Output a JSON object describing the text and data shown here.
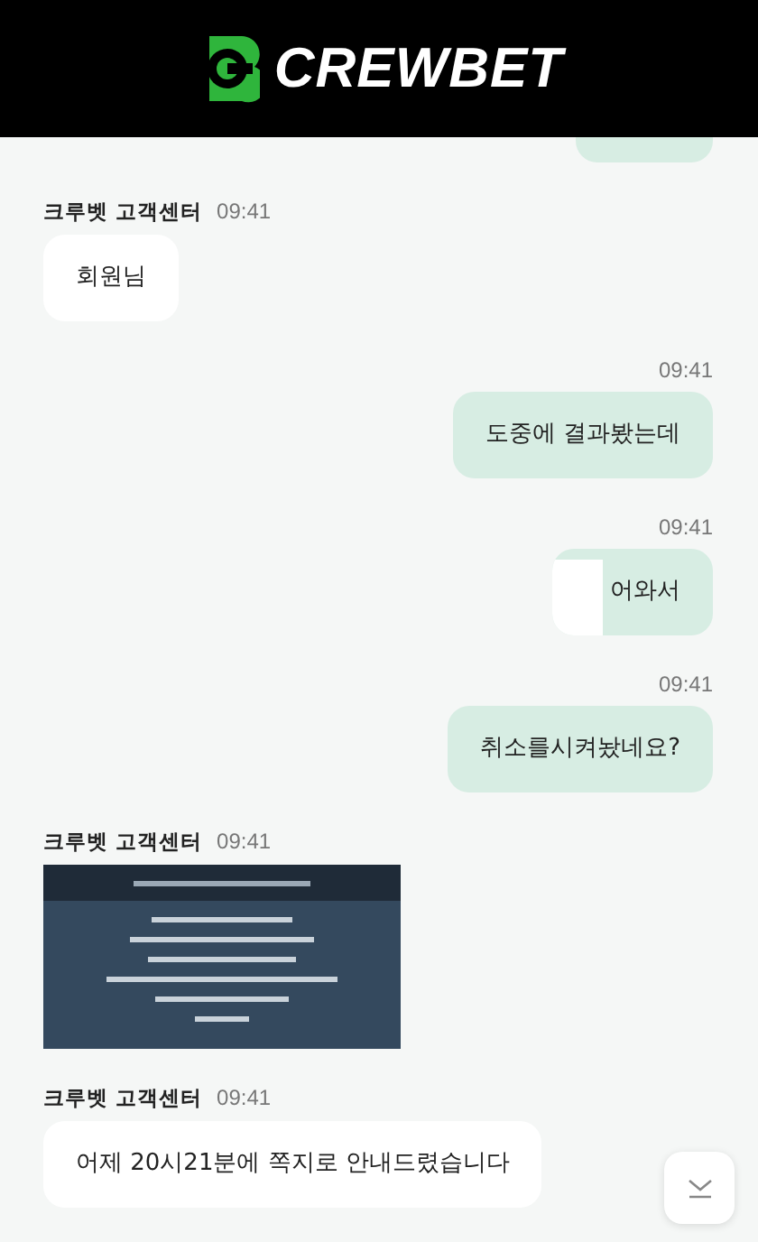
{
  "header": {
    "logo_text": "CREWBET"
  },
  "messages": [
    {
      "kind": "clipped",
      "mine": true
    },
    {
      "kind": "text",
      "mine": false,
      "sender": "크루벳 고객센터",
      "time": "09:41",
      "text": "회원님"
    },
    {
      "kind": "text",
      "mine": true,
      "time": "09:41",
      "text": "도중에 결과봤는데"
    },
    {
      "kind": "text",
      "mine": true,
      "time": "09:41",
      "text": "어와서",
      "redacted": true
    },
    {
      "kind": "text",
      "mine": true,
      "time": "09:41",
      "text": "취소를시켜놨네요?"
    },
    {
      "mine": false,
      "sender": "크루벳 고객센터",
      "time": "09:41"
    },
    {
      "kind": "text",
      "mine": false,
      "sender": "크루벳 고객센터",
      "time": "09:41",
      "text": "어제 20시21분에 쪽지로 안내드렸습니다"
    }
  ]
}
